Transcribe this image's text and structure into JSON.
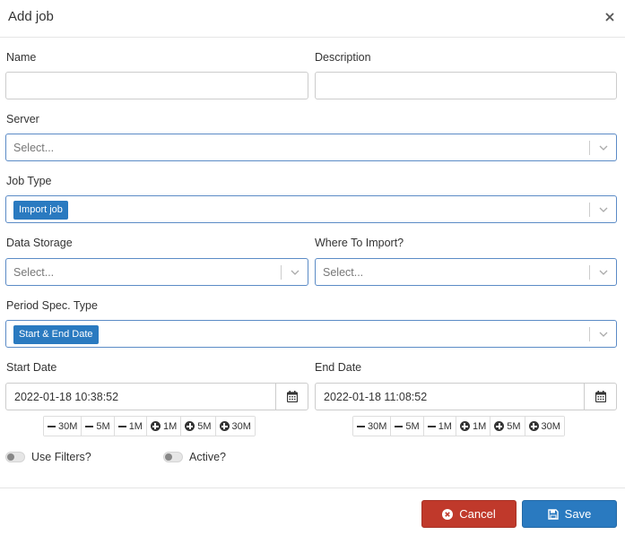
{
  "modal": {
    "title": "Add job"
  },
  "fields": {
    "name_label": "Name",
    "description_label": "Description",
    "server_label": "Server",
    "server_placeholder": "Select...",
    "job_type_label": "Job Type",
    "job_type_value": "Import job",
    "data_storage_label": "Data Storage",
    "data_storage_placeholder": "Select...",
    "where_import_label": "Where To Import?",
    "where_import_placeholder": "Select...",
    "period_label": "Period Spec. Type",
    "period_value": "Start & End Date",
    "start_date_label": "Start Date",
    "start_date_value": "2022-01-18 10:38:52",
    "end_date_label": "End Date",
    "end_date_value": "2022-01-18 11:08:52"
  },
  "steps": {
    "minus": [
      "30M",
      "5M",
      "1M"
    ],
    "plus": [
      "1M",
      "5M",
      "30M"
    ]
  },
  "toggles": {
    "filters_label": "Use Filters?",
    "filters_on": false,
    "active_label": "Active?",
    "active_on": false
  },
  "buttons": {
    "cancel": "Cancel",
    "save": "Save"
  },
  "colors": {
    "primary": "#2a7ac0",
    "danger": "#c0392b"
  },
  "icons": [
    "close-icon",
    "chevron-down-icon",
    "calendar-icon",
    "minus-icon",
    "plus-circle-icon",
    "cancel-circle-icon",
    "save-icon"
  ]
}
